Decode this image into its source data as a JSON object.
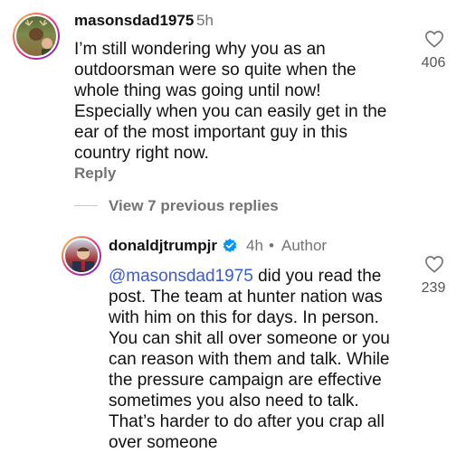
{
  "comment1": {
    "username": "masonsdad1975",
    "time": "5h",
    "text": "I’m still wondering why you as an\noutdoorsman were so quite when the\nwhole thing was going until now!\nEspecially when you can easily get in the\near of the most important guy in this\ncountry right now.",
    "likes": "406",
    "reply_label": "Reply"
  },
  "view_replies_label": "View 7 previous replies",
  "comment2": {
    "username": "donaldjtrumpjr",
    "time": "4h",
    "separator": "•",
    "author_label": "Author",
    "mention": "@masonsdad1975",
    "text_first": " did you read the",
    "text": "post. The team at hunter nation was\nwith him on this for days. In person.\nYou can shit all over someone or you\ncan reason with them and talk. While\nthe pressure campaign are effective\nsometimes you also need to talk.\nThat’s harder to do after you crap all\nover someone",
    "likes": "239"
  },
  "icons": {
    "like": "heart-outline-icon",
    "verified": "verified-badge-icon"
  },
  "colors": {
    "mention": "#3a5bd9",
    "verified": "#0095f6",
    "muted": "#737373"
  }
}
